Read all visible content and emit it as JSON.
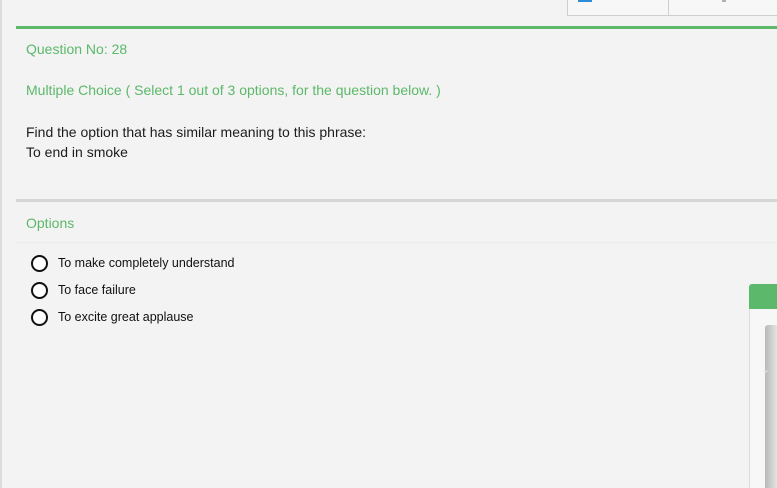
{
  "question": {
    "number_label": "Question No: 28",
    "type_label": "Multiple Choice ( Select 1 out of 3 options, for the question below. )",
    "prompt_line1": "Find the option that has similar meaning to this phrase:",
    "prompt_line2": "To end in smoke"
  },
  "options": {
    "title": "Options",
    "items": [
      {
        "label": "To make completely understand",
        "selected": false
      },
      {
        "label": "To face failure",
        "selected": false
      },
      {
        "label": "To excite great applause",
        "selected": false
      }
    ]
  },
  "colors": {
    "accent_green": "#5cb86a",
    "tab_accent_blue": "#2e8bd6",
    "divider_gray": "#d6d6d6"
  },
  "icons": {
    "side_panel_chevron": "chevron-icon"
  }
}
